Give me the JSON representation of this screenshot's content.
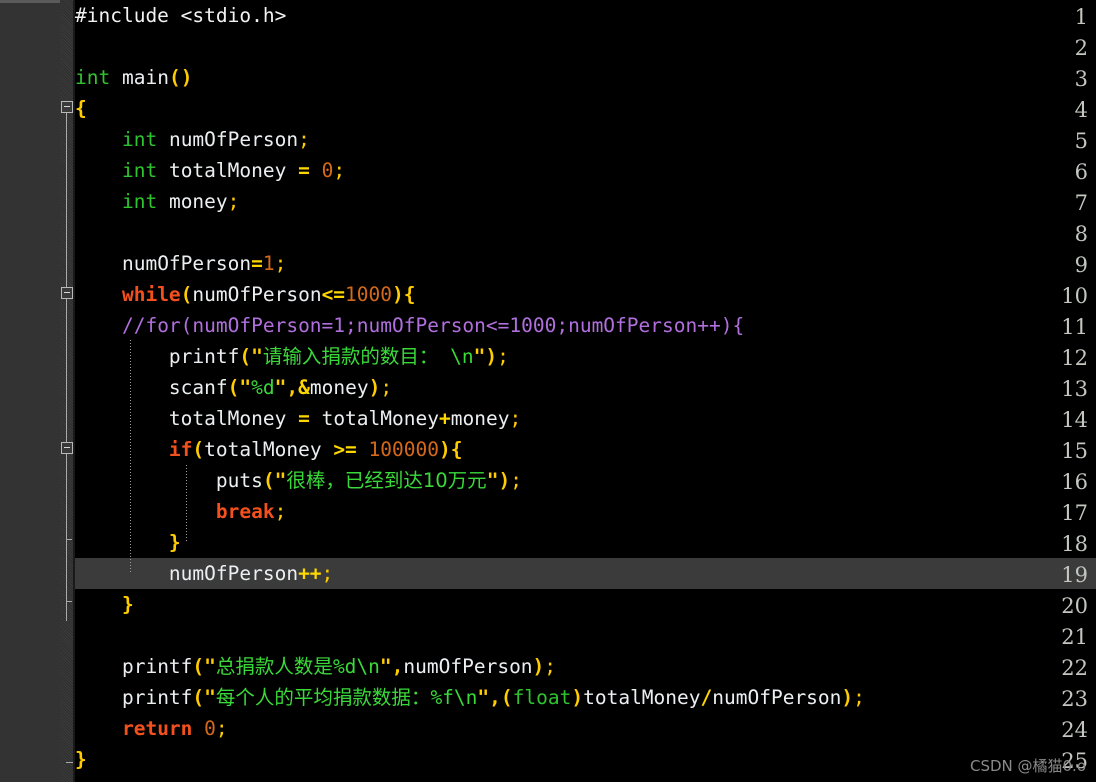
{
  "editor": {
    "language": "C",
    "theme": "dark",
    "highlighted_line": 19,
    "first_line": 1,
    "last_line": 25,
    "colors": {
      "background": "#000000",
      "gutter_background": "#333333",
      "line_number": "#c3c7c0",
      "highlight_row": "#3b3b3b",
      "keyword": "#f4501e",
      "type": "#2fc32f",
      "string": "#3ad93a",
      "comment": "#b06fdd",
      "number": "#d4691a",
      "punctuation": "#ffcc00",
      "operator": "#ffd700",
      "identifier": "#eceff1",
      "watermark": "#8a8a8a"
    }
  },
  "line_numbers": [
    "1",
    "2",
    "3",
    "4",
    "5",
    "6",
    "7",
    "8",
    "9",
    "10",
    "11",
    "12",
    "13",
    "14",
    "15",
    "16",
    "17",
    "18",
    "19",
    "20",
    "21",
    "22",
    "23",
    "24",
    "25"
  ],
  "code_lines": [
    {
      "n": 1,
      "text": "#include <stdio.h>"
    },
    {
      "n": 2,
      "text": ""
    },
    {
      "n": 3,
      "text": "int main()"
    },
    {
      "n": 4,
      "text": "{"
    },
    {
      "n": 5,
      "text": "    int numOfPerson;"
    },
    {
      "n": 6,
      "text": "    int totalMoney = 0;"
    },
    {
      "n": 7,
      "text": "    int money;"
    },
    {
      "n": 8,
      "text": ""
    },
    {
      "n": 9,
      "text": "    numOfPerson=1;"
    },
    {
      "n": 10,
      "text": "    while(numOfPerson<=1000){"
    },
    {
      "n": 11,
      "text": "    //for(numOfPerson=1;numOfPerson<=1000;numOfPerson++){"
    },
    {
      "n": 12,
      "text": "        printf(\"请输入捐款的数目：\\n\");"
    },
    {
      "n": 13,
      "text": "        scanf(\"%d\",&money);"
    },
    {
      "n": 14,
      "text": "        totalMoney = totalMoney+money;"
    },
    {
      "n": 15,
      "text": "        if(totalMoney >= 100000){"
    },
    {
      "n": 16,
      "text": "            puts(\"很棒，已经到达10万元\");"
    },
    {
      "n": 17,
      "text": "            break;"
    },
    {
      "n": 18,
      "text": "        }"
    },
    {
      "n": 19,
      "text": "        numOfPerson++;"
    },
    {
      "n": 20,
      "text": "    }"
    },
    {
      "n": 21,
      "text": ""
    },
    {
      "n": 22,
      "text": "    printf(\"总捐款人数是%d\\n\",numOfPerson);"
    },
    {
      "n": 23,
      "text": "    printf(\"每个人的平均捐款数据：%f\\n\",(float)totalMoney/numOfPerson);"
    },
    {
      "n": 24,
      "text": "    return 0;"
    },
    {
      "n": 25,
      "text": "}"
    }
  ],
  "strings": {
    "prompt_input_donation": "请输入捐款的数目：\\n",
    "reached_goal": "很棒，已经到达10万元",
    "total_people": "总捐款人数是%d\\n",
    "average_donation": "每个人的平均捐款数据：%f\\n"
  },
  "fold_markers": [
    {
      "line": 4,
      "state": "expanded"
    },
    {
      "line": 10,
      "state": "expanded"
    },
    {
      "line": 15,
      "state": "expanded"
    }
  ],
  "watermark": {
    "text": "CSDN @橘猫0.o"
  }
}
